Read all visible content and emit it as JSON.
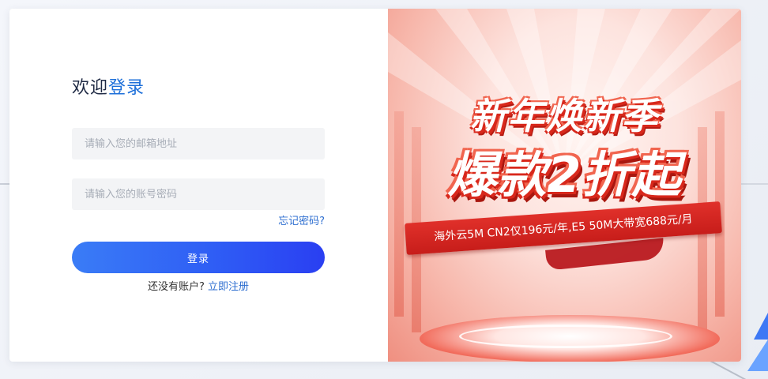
{
  "login": {
    "title_prefix": "欢迎",
    "title_accent": "登录",
    "email_placeholder": "请输入您的邮箱地址",
    "password_placeholder": "请输入您的账号密码",
    "forgot_password": "忘记密码?",
    "submit_label": "登录",
    "no_account_text": "还没有账户?",
    "register_link": "立即注册"
  },
  "banner": {
    "headline_1": "新年焕新季",
    "headline_2": "爆款2折起",
    "ribbon_text": "海外云5M CN2仅196元/年,E5 50M大带宽688元/月"
  },
  "colors": {
    "accent": "#1d6fd9",
    "button_start": "#3a7cf6",
    "button_end": "#2a3ff2",
    "banner_red": "#d8281c"
  }
}
